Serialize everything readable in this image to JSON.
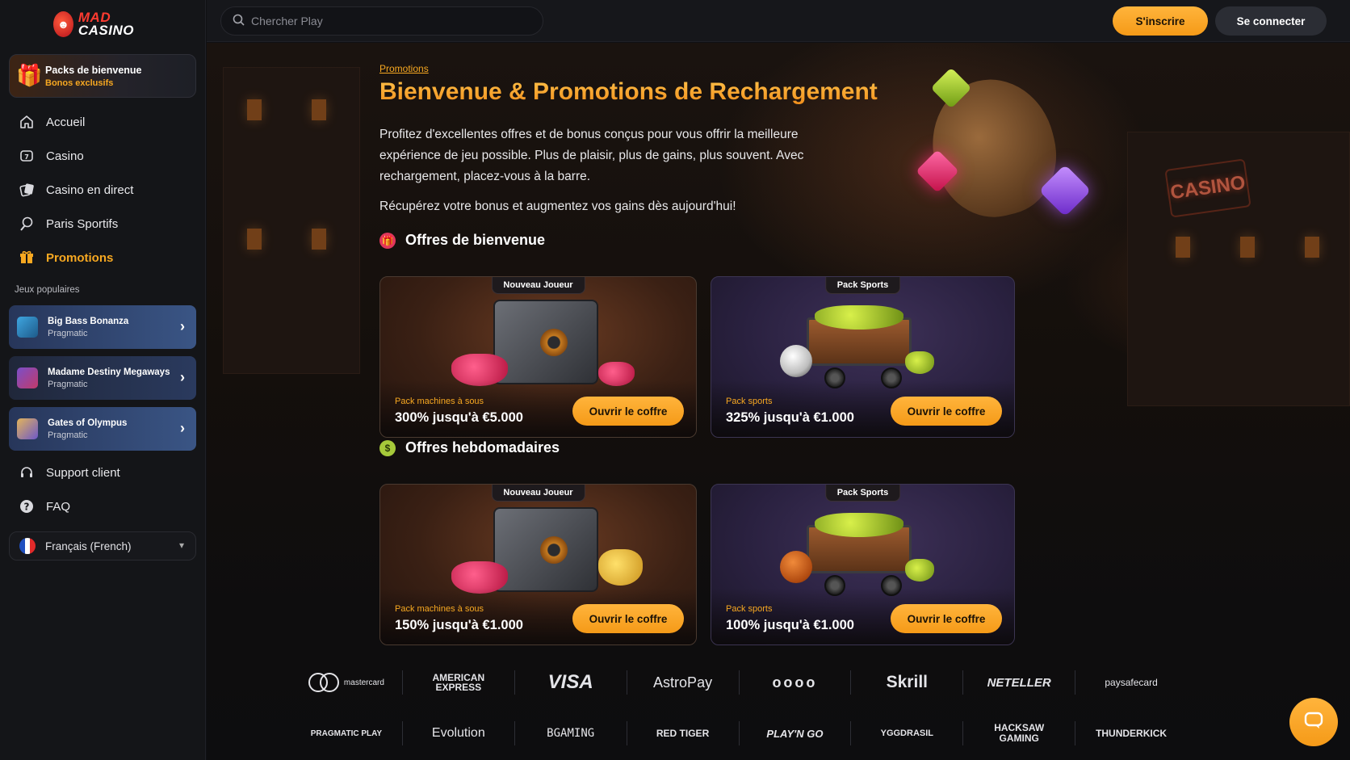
{
  "logo": {
    "mad": "MAD",
    "casino": "CASINO"
  },
  "search": {
    "placeholder": "Chercher Play"
  },
  "header": {
    "signup_label": "S'inscrire",
    "login_label": "Se connecter"
  },
  "sidebar": {
    "welcome_pack": {
      "title": "Packs de bienvenue",
      "subtitle": "Bonos exclusifs"
    },
    "nav": [
      {
        "label": "Accueil",
        "icon": "home-icon"
      },
      {
        "label": "Casino",
        "icon": "casino-icon"
      },
      {
        "label": "Casino en direct",
        "icon": "live-casino-icon"
      },
      {
        "label": "Paris Sportifs",
        "icon": "sports-icon"
      },
      {
        "label": "Promotions",
        "icon": "gift-icon",
        "active": true
      }
    ],
    "popular_label": "Jeux populaires",
    "games": [
      {
        "title": "Big Bass Bonanza",
        "provider": "Pragmatic"
      },
      {
        "title": "Madame Destiny Megaways",
        "provider": "Pragmatic"
      },
      {
        "title": "Gates of Olympus",
        "provider": "Pragmatic"
      }
    ],
    "nav2": [
      {
        "label": "Support client",
        "icon": "headset-icon"
      },
      {
        "label": "FAQ",
        "icon": "question-icon"
      }
    ],
    "language": "Français (French)"
  },
  "main": {
    "breadcrumb": "Promotions",
    "title": "Bienvenue & Promotions de Rechargement",
    "intro": "Profitez d'excellentes offres et de bonus conçus pour vous offrir la meilleure expérience de jeu possible. Plus de plaisir, plus de gains, plus souvent. Avec rechargement, placez-vous à la barre.",
    "intro2": "Récupérez votre bonus et augmentez vos gains dès aujourd'hui!",
    "bg_sign": "CASINO",
    "welcome_section": {
      "title": "Offres de bienvenue",
      "cards": [
        {
          "tag": "Nouveau Joueur",
          "subtitle": "Pack machines à sous",
          "value": "300% jusqu'à €5.000",
          "button": "Ouvrir le coffre"
        },
        {
          "tag": "Pack Sports",
          "subtitle": "Pack sports",
          "value": "325% jusqu'à €1.000",
          "button": "Ouvrir le coffre"
        }
      ]
    },
    "weekly_section": {
      "title": "Offres hebdomadaires",
      "cards": [
        {
          "tag": "Nouveau Joueur",
          "subtitle": "Pack machines à sous",
          "value": "150% jusqu'à €1.000",
          "button": "Ouvrir le coffre"
        },
        {
          "tag": "Pack Sports",
          "subtitle": "Pack sports",
          "value": "100% jusqu'à €1.000",
          "button": "Ouvrir le coffre"
        }
      ]
    }
  },
  "payments": [
    "mastercard",
    "AMERICAN EXPRESS",
    "VISA",
    "AstroPay",
    "oooo",
    "Skrill",
    "NETELLER",
    "paysafecard"
  ],
  "providers": [
    "PRAGMATIC PLAY",
    "Evolution",
    "BGAMING",
    "RED TIGER",
    "PLAY'N GO",
    "YGGDRASIL",
    "HACKSAW GAMING",
    "THUNDERKICK"
  ],
  "colors": {
    "accent": "#f7a821",
    "sidebar_bg": "#141518",
    "game_card": "#2a3a5e"
  }
}
